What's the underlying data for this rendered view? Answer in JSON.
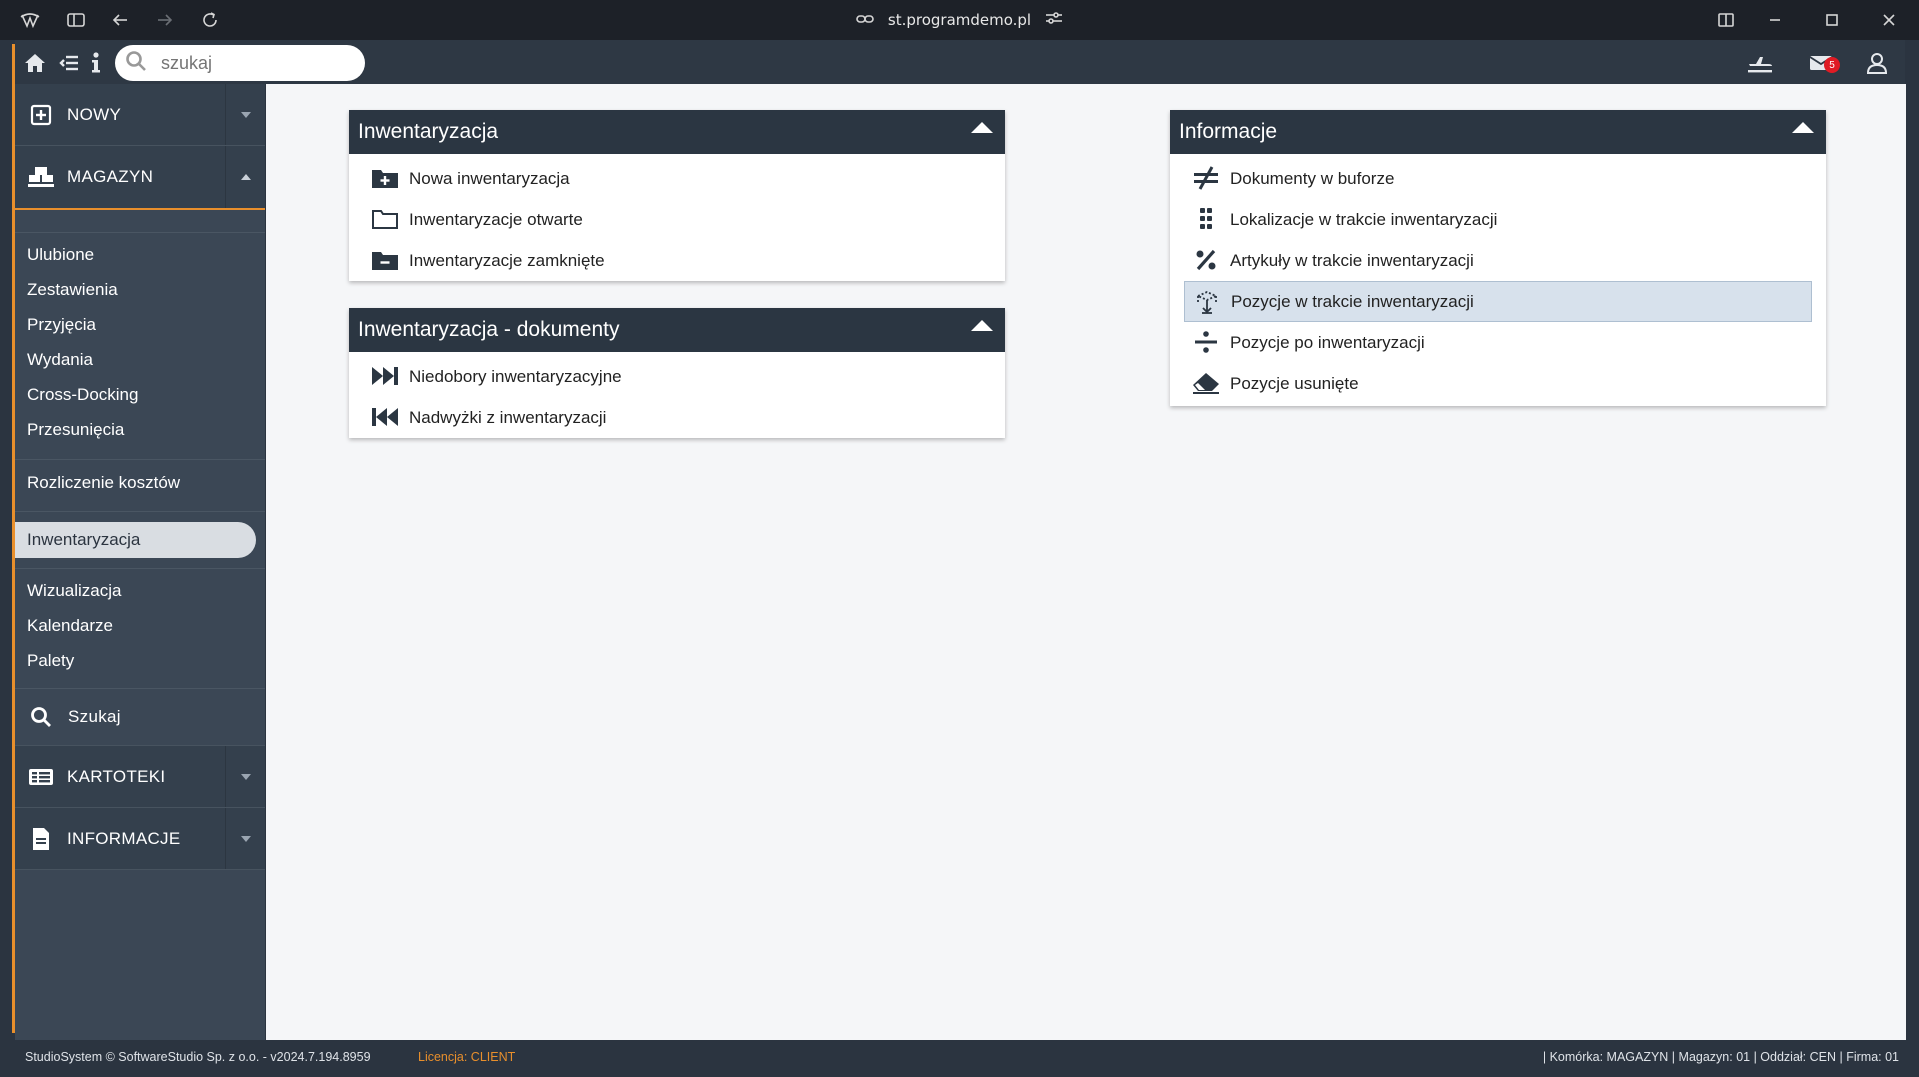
{
  "browser": {
    "url": "st.programdemo.pl"
  },
  "toolbar": {
    "search_placeholder": "szukaj",
    "mail_count": "5"
  },
  "sidebar": {
    "nowy": "NOWY",
    "magazyn": "MAGAZYN",
    "items_a": [
      "Ulubione",
      "Zestawienia",
      "Przyjęcia",
      "Wydania",
      "Cross-Docking",
      "Przesunięcia"
    ],
    "rozliczenie": "Rozliczenie kosztów",
    "inwentaryzacja": "Inwentaryzacja",
    "items_b": [
      "Wizualizacja",
      "Kalendarze",
      "Palety"
    ],
    "szukaj": "Szukaj",
    "kartoteki": "KARTOTEKI",
    "informacje": "INFORMACJE"
  },
  "panels": {
    "inw": {
      "title": "Inwentaryzacja",
      "rows": [
        "Nowa inwentaryzacja",
        "Inwentaryzacje otwarte",
        "Inwentaryzacje zamknięte"
      ]
    },
    "dok": {
      "title": "Inwentaryzacja - dokumenty",
      "rows": [
        "Niedobory inwentaryzacyjne",
        "Nadwyżki z inwentaryzacji"
      ]
    },
    "info": {
      "title": "Informacje",
      "rows": [
        "Dokumenty w buforze",
        "Lokalizacje w trakcie inwentaryzacji",
        "Artykuły w trakcie inwentaryzacji",
        "Pozycje w trakcie inwentaryzacji",
        "Pozycje po inwentaryzacji",
        "Pozycje usunięte"
      ]
    }
  },
  "footer": {
    "left": "StudioSystem © SoftwareStudio Sp. z o.o. - v2024.7.194.8959",
    "license": "Licencja: CLIENT",
    "right": "| Komórka: MAGAZYN | Magazyn: 01 | Oddział: CEN | Firma: 01"
  }
}
